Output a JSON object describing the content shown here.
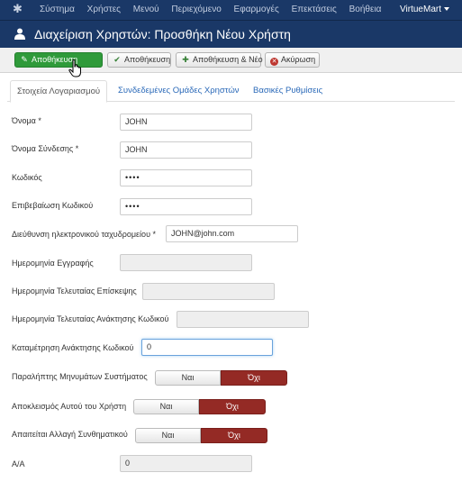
{
  "topnav": {
    "menu": [
      "Σύστημα",
      "Χρήστες",
      "Μενού",
      "Περιεχόμενο",
      "Εφαρμογές",
      "Επεκτάσεις",
      "Βοήθεια"
    ],
    "right_menu": "VirtueMart"
  },
  "header": {
    "title": "Διαχείριση Χρηστών: Προσθήκη Νέου Χρήστη"
  },
  "toolbar": {
    "save": "Αποθήκευση",
    "save_close": "Αποθήκευση",
    "save_new": "Αποθήκευση & Νέο",
    "cancel": "Ακύρωση"
  },
  "tabs": [
    "Στοιχεία Λογαριασμού",
    "Συνδεδεμένες Ομάδες Χρηστών",
    "Βασικές Ρυθμίσεις"
  ],
  "form": {
    "name": {
      "label": "Όνομα *",
      "value": "JOHN"
    },
    "username": {
      "label": "Όνομα Σύνδεσης *",
      "value": "JOHN"
    },
    "password": {
      "label": "Κωδικός",
      "value": "••••"
    },
    "password2": {
      "label": "Επιβεβαίωση Κωδικού",
      "value": "••••"
    },
    "email": {
      "label": "Διεύθυνση ηλεκτρονικού ταχυδρομείου *",
      "value": "JOHN@john.com"
    },
    "register_date": {
      "label": "Ημερομηνία Εγγραφής",
      "value": ""
    },
    "last_visit": {
      "label": "Ημερομηνία Τελευταίας Επίσκεψης",
      "value": ""
    },
    "last_reset": {
      "label": "Ημερομηνία Τελευταίας Ανάκτησης Κωδικού",
      "value": ""
    },
    "reset_count": {
      "label": "Καταμέτρηση Ανάκτησης Κωδικού",
      "value": "0"
    },
    "send_email": {
      "label": "Παραλήπτης Μηνυμάτων Συστήματος",
      "no": "Ναι",
      "yes": "Όχι",
      "selected": "Όχι"
    },
    "block": {
      "label": "Αποκλεισμός Αυτού του Χρήστη",
      "no": "Ναι",
      "yes": "Όχι",
      "selected": "Όχι"
    },
    "require_reset": {
      "label": "Απαιτείται Αλλαγή Συνθηματικού",
      "no": "Ναι",
      "yes": "Όχι",
      "selected": "Όχι"
    },
    "id": {
      "label": "Α/Α",
      "value": "0"
    }
  },
  "colors": {
    "nav": "#1a3867",
    "primary": "#2f9a3a",
    "danger": "#942a25",
    "link": "#2a69b8"
  },
  "icons": {
    "logo": "joomla-icon",
    "header": "user-icon",
    "save": "edit-icon",
    "save_close": "check-icon",
    "save_new": "plus-icon",
    "cancel": "cancel-icon"
  }
}
